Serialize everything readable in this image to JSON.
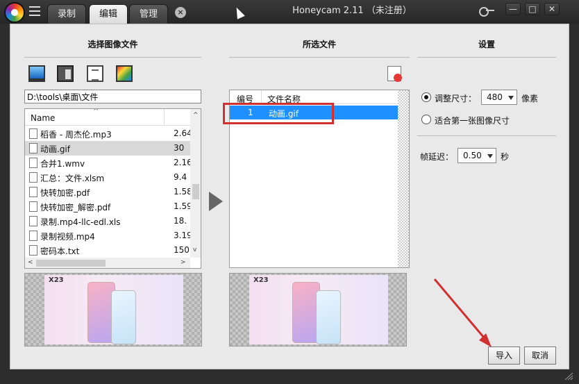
{
  "titlebar": {
    "app_title": "Honeycam 2.11 （未注册）",
    "tabs": [
      {
        "label": "录制"
      },
      {
        "label": "编辑"
      },
      {
        "label": "管理"
      }
    ],
    "tab_close": "×",
    "minimize": "—",
    "maximize": "□",
    "close": "✕"
  },
  "left": {
    "header": "选择图像文件",
    "path": "D:\\tools\\桌面\\文件",
    "column_name": "Name",
    "files": [
      {
        "name": "稻香 - 周杰伦.mp3",
        "size": "2.64"
      },
      {
        "name": "动画.gif",
        "size": "30"
      },
      {
        "name": "合并1.wmv",
        "size": "2.16"
      },
      {
        "name": "汇总：文件.xlsm",
        "size": "9.4"
      },
      {
        "name": "快转加密.pdf",
        "size": "1.58"
      },
      {
        "name": "快转加密_解密.pdf",
        "size": "1.59"
      },
      {
        "name": "录制.mp4-llc-edl.xls",
        "size": "18."
      },
      {
        "name": "录制视频.mp4",
        "size": "3.19"
      },
      {
        "name": "密码本.txt",
        "size": "150"
      }
    ],
    "selected_index": 1
  },
  "middle": {
    "header": "所选文件",
    "col_index": "编号",
    "col_filename": "文件名称",
    "rows": [
      {
        "index": "1",
        "filename": "动画.gif"
      }
    ]
  },
  "preview": {
    "brand_text": "X23"
  },
  "settings": {
    "header": "设置",
    "resize_label": "调整尺寸：",
    "resize_value": "480",
    "resize_unit": "像素",
    "fit_first_label": "适合第一张图像尺寸",
    "delay_label": "帧延迟：",
    "delay_value": "0.50",
    "delay_unit": "秒"
  },
  "footer": {
    "import_label": "导入",
    "cancel_label": "取消"
  },
  "colors": {
    "selection_blue": "#1e90ff",
    "highlight_red": "#d32f2f"
  }
}
